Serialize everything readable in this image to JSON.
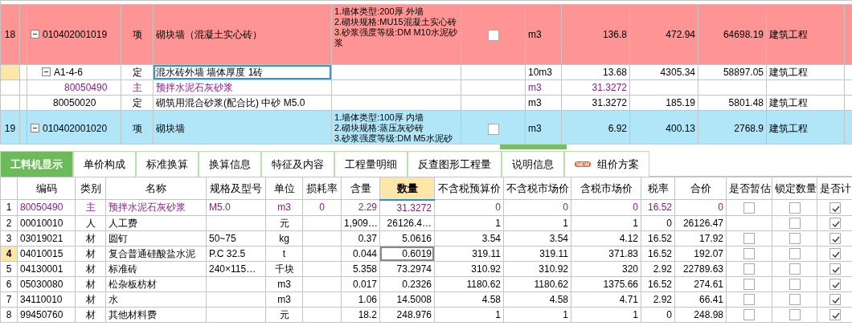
{
  "upper_grid": {
    "rows": [
      {
        "number": "18",
        "code": "010402001019",
        "type": "项",
        "name": "砌块墙（混凝土实心砖）",
        "features": [
          "1.墙体类型:200厚 外墙",
          "2.砌块规格:MU15混凝土实心砖",
          "3.砂浆强度等级:DM M10水泥砂浆"
        ],
        "checked": false,
        "unit": "m3",
        "quantity": "136.8",
        "price": "472.94",
        "total": "64698.19",
        "category": "建筑工程",
        "kind": "item",
        "color": "#ff9494",
        "expanded": true,
        "selected": false,
        "children": [
          {
            "code": "A1-4-6",
            "type": "定",
            "name": "混水砖外墙 墙体厚度 1砖",
            "unit": "10m3",
            "quantity": "13.68",
            "price": "4305.34",
            "total": "58897.05",
            "category": "建筑工程",
            "kind": "quota",
            "expanded": true,
            "selected": true,
            "children": [
              {
                "code": "80050490",
                "type": "主",
                "name": "预拌水泥石灰砂浆",
                "unit": "m3",
                "quantity": "31.3272",
                "kind": "main",
                "selected": false
              }
            ]
          },
          {
            "code": "80050020",
            "type": "定",
            "name": "砌筑用混合砂浆(配合比) 中砂 M5.0",
            "unit": "m3",
            "quantity": "31.3272",
            "price": "185.19",
            "total": "5801.48",
            "category": "建筑工程",
            "kind": "quota",
            "selected": false
          }
        ]
      },
      {
        "number": "19",
        "code": "010402001020",
        "type": "项",
        "name": "砌块墙",
        "features": [
          "1.墙体类型:100厚 内墙",
          "2.砌块规格:蒸压灰砂砖",
          "3.砂浆强度等级:DM M5水泥砂"
        ],
        "checked": false,
        "unit": "m3",
        "quantity": "6.92",
        "price": "400.13",
        "total": "2768.9",
        "category": "建筑工程",
        "kind": "item",
        "color": "#b0e6f8",
        "expanded": true,
        "selected": false
      }
    ]
  },
  "tabs": [
    {
      "label": "工料机显示",
      "selected": true
    },
    {
      "label": "单价构成",
      "selected": false
    },
    {
      "label": "标准换算",
      "selected": false
    },
    {
      "label": "换算信息",
      "selected": false
    },
    {
      "label": "特征及内容",
      "selected": false
    },
    {
      "label": "工程量明细",
      "selected": false
    },
    {
      "label": "反查图形工程量",
      "selected": false
    },
    {
      "label": "说明信息",
      "selected": false
    },
    {
      "label": "组价方案",
      "badge": "NEW",
      "selected": false
    }
  ],
  "resource_table": {
    "columns": [
      {},
      {
        "label": "编码"
      },
      {
        "label": "类别"
      },
      {
        "label": "名称"
      },
      {
        "label": "规格及型号"
      },
      {
        "label": "单位"
      },
      {
        "label": "损耗率"
      },
      {
        "label": "含量"
      },
      {
        "label": "数量",
        "active": true
      },
      {
        "label": "不含税预算价"
      },
      {
        "label": "不含税市场价"
      },
      {
        "label": "含税市场价"
      },
      {
        "label": "税率"
      },
      {
        "label": "合价"
      },
      {
        "label": "是否暂估"
      },
      {
        "label": "锁定数量"
      },
      {
        "label": "是否计"
      }
    ],
    "rows": [
      {
        "number": "1",
        "code": "80050490",
        "type": "主",
        "name": "预拌水泥石灰砂浆",
        "spec": "M5.0",
        "unit": "m3",
        "loss_rate": "0",
        "content": "2.29",
        "quantity": "31.3272",
        "budget_price": "0",
        "market_price": "0",
        "market_price_tax": "0",
        "tax_rate": "16.52",
        "total": "0",
        "estimate": false,
        "lock": false,
        "counted": true,
        "kind": "main",
        "selected": false
      },
      {
        "number": "2",
        "code": "00010010",
        "type": "人",
        "name": "人工费",
        "unit": "元",
        "content": "1,909…",
        "quantity": "26126.4…",
        "budget_price": "1",
        "market_price": "1",
        "market_price_tax": "1",
        "tax_rate": "0",
        "total": "26126.47",
        "lock": false,
        "counted": true,
        "kind": "normal",
        "selected": false
      },
      {
        "number": "3",
        "code": "03019021",
        "type": "材",
        "name": "圆钉",
        "spec": "50~75",
        "unit": "kg",
        "content": "0.37",
        "quantity": "5.0616",
        "budget_price": "3.54",
        "market_price": "3.54",
        "market_price_tax": "4.12",
        "tax_rate": "16.52",
        "total": "17.92",
        "estimate": false,
        "lock": false,
        "counted": true,
        "kind": "normal",
        "selected": false
      },
      {
        "number": "4",
        "code": "04010015",
        "type": "材",
        "name": "复合普通硅酸盐水泥",
        "spec": "P.C 32.5",
        "unit": "t",
        "content": "0.044",
        "quantity": "0.6019",
        "budget_price": "319.11",
        "market_price": "319.11",
        "market_price_tax": "371.83",
        "tax_rate": "16.52",
        "total": "192.07",
        "estimate": false,
        "lock": false,
        "counted": true,
        "kind": "normal",
        "selected": true
      },
      {
        "number": "5",
        "code": "04130001",
        "type": "材",
        "name": "标准砖",
        "spec": "240×115…",
        "unit": "千块",
        "content": "5.358",
        "quantity": "73.2974",
        "budget_price": "310.92",
        "market_price": "310.92",
        "market_price_tax": "320",
        "tax_rate": "2.92",
        "total": "22789.63",
        "estimate": false,
        "lock": false,
        "counted": true,
        "kind": "normal",
        "selected": false
      },
      {
        "number": "6",
        "code": "05030080",
        "type": "材",
        "name": "松杂板枋材",
        "unit": "m3",
        "content": "0.017",
        "quantity": "0.2326",
        "budget_price": "1180.62",
        "market_price": "1180.62",
        "market_price_tax": "1375.66",
        "tax_rate": "16.52",
        "total": "274.61",
        "estimate": false,
        "lock": false,
        "counted": true,
        "kind": "normal",
        "selected": false
      },
      {
        "number": "7",
        "code": "34110010",
        "type": "材",
        "name": "水",
        "unit": "m3",
        "content": "1.06",
        "quantity": "14.5008",
        "budget_price": "4.58",
        "market_price": "4.58",
        "market_price_tax": "4.71",
        "tax_rate": "2.92",
        "total": "66.41",
        "estimate": false,
        "lock": false,
        "counted": true,
        "kind": "normal",
        "selected": false
      },
      {
        "number": "8",
        "code": "99450760",
        "type": "材",
        "name": "其他材料费",
        "unit": "元",
        "content": "18.2",
        "quantity": "248.976",
        "budget_price": "1",
        "market_price": "1",
        "market_price_tax": "1",
        "tax_rate": "0",
        "total": "248.98",
        "estimate": false,
        "lock": false,
        "counted": true,
        "kind": "normal",
        "selected": false
      }
    ]
  }
}
